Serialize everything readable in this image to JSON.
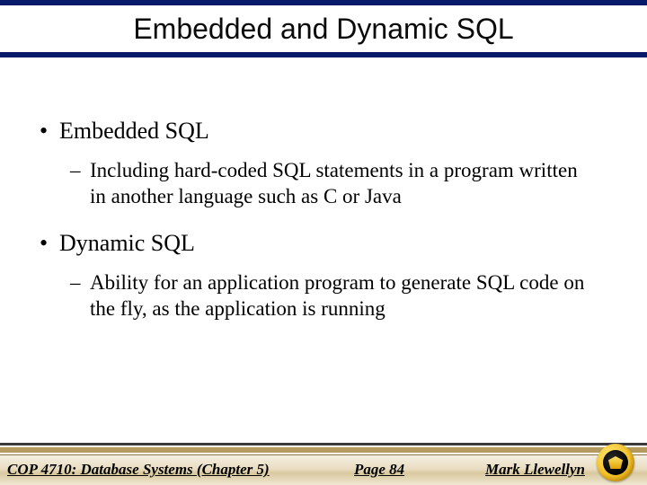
{
  "title": "Embedded and Dynamic SQL",
  "bullets": [
    {
      "label": "Embedded SQL",
      "sub": "Including hard-coded SQL statements in a program written in another language such as C or Java"
    },
    {
      "label": "Dynamic SQL",
      "sub": "Ability for an application program to generate SQL code on the fly, as the application is running"
    }
  ],
  "footer": {
    "course": "COP 4710: Database Systems  (Chapter 5)",
    "page": "Page 84",
    "author": "Mark Llewellyn"
  }
}
